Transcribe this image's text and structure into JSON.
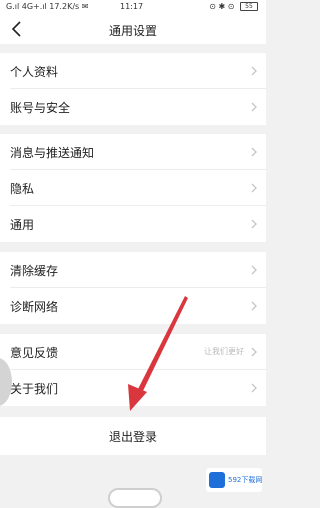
{
  "status_bar": {
    "left": "G.ıl 4G+.ıl 17.2K/s ✉",
    "time": "11:17",
    "right": "⊙ ✱ ⊙",
    "battery": "55"
  },
  "header": {
    "title": "通用设置"
  },
  "groups": [
    {
      "items": [
        {
          "label": "个人资料"
        },
        {
          "label": "账号与安全"
        }
      ]
    },
    {
      "items": [
        {
          "label": "消息与推送通知"
        },
        {
          "label": "隐私"
        },
        {
          "label": "通用"
        }
      ]
    },
    {
      "items": [
        {
          "label": "清除缓存"
        },
        {
          "label": "诊断网络"
        }
      ]
    },
    {
      "items": [
        {
          "label": "意见反馈",
          "hint": "让我们更好"
        },
        {
          "label": "关于我们"
        }
      ]
    }
  ],
  "logout": {
    "label": "退出登录"
  },
  "colors": {
    "background": "#f1f1f1",
    "row_background": "#ffffff",
    "annotation_arrow": "#d9363e",
    "watermark_brand": "#1e6fd9"
  },
  "watermark": {
    "text": "592下载网"
  }
}
